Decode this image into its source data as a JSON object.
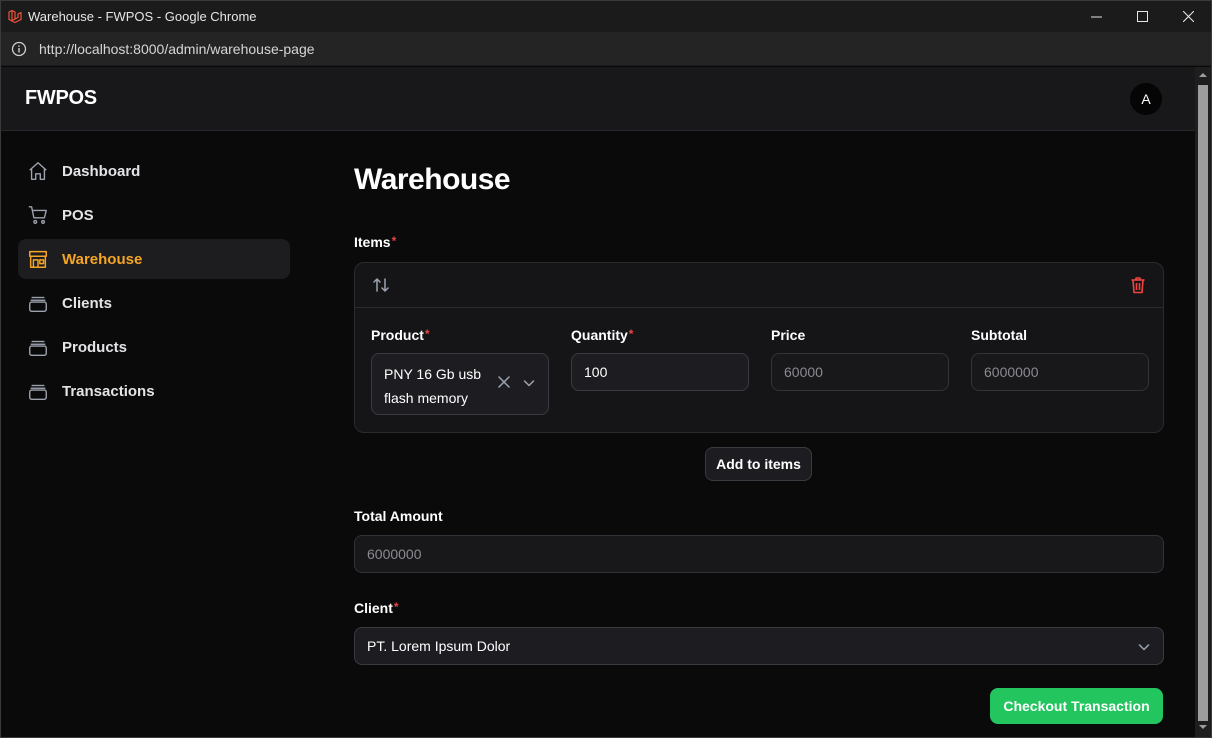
{
  "browser": {
    "window_title": "Warehouse - FWPOS - Google Chrome",
    "url_prefix": "http://",
    "url_host": "localhost",
    "url_rest": ":8000/admin/warehouse-page"
  },
  "app": {
    "brand": "FWPOS",
    "avatar_initial": "A"
  },
  "sidebar": {
    "items": [
      {
        "label": "Dashboard",
        "icon": "home-icon",
        "active": false
      },
      {
        "label": "POS",
        "icon": "cart-icon",
        "active": false
      },
      {
        "label": "Warehouse",
        "icon": "store-icon",
        "active": true
      },
      {
        "label": "Clients",
        "icon": "stack-icon",
        "active": false
      },
      {
        "label": "Products",
        "icon": "stack-icon",
        "active": false
      },
      {
        "label": "Transactions",
        "icon": "stack-icon",
        "active": false
      }
    ]
  },
  "main": {
    "heading": "Warehouse",
    "items_label": "Items",
    "required_mark": "*",
    "item": {
      "product_label": "Product",
      "product_value": "PNY 16 Gb usb flash memory",
      "quantity_label": "Quantity",
      "quantity_value": "100",
      "price_label": "Price",
      "price_value": "60000",
      "subtotal_label": "Subtotal",
      "subtotal_value": "6000000"
    },
    "add_button": "Add to items",
    "total_label": "Total Amount",
    "total_value": "6000000",
    "client_label": "Client",
    "client_value": "PT. Lorem Ipsum Dolor",
    "checkout_button": "Checkout Transaction"
  },
  "colors": {
    "accent": "#f5a524",
    "success": "#22c55e",
    "danger": "#ef4444"
  }
}
